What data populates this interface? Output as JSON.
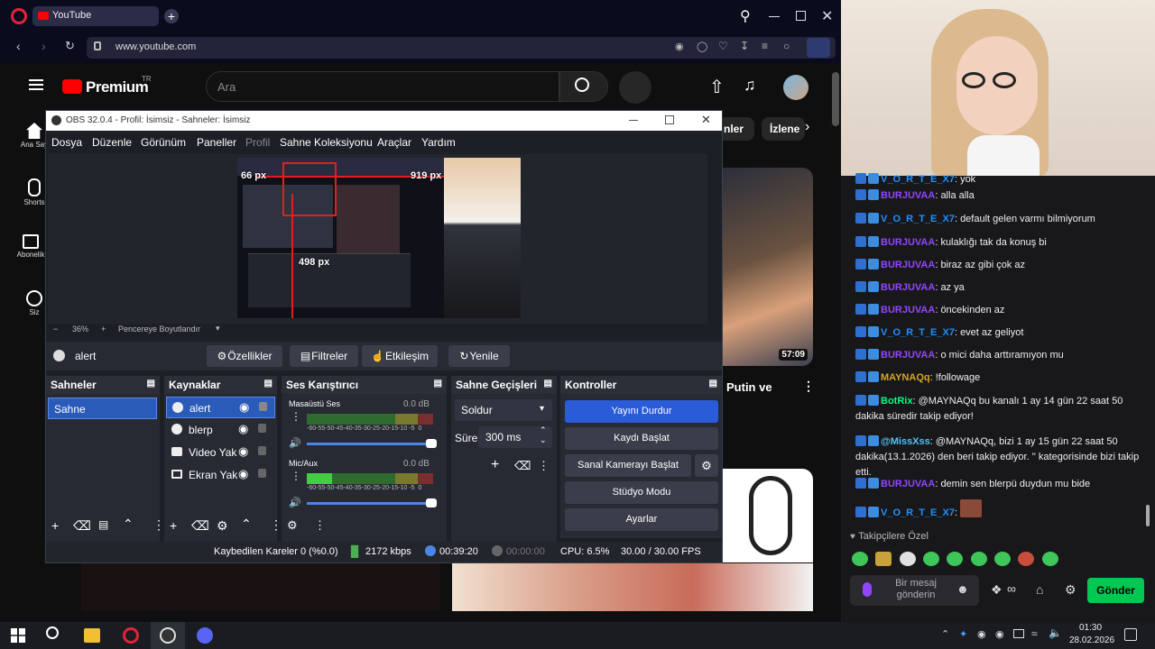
{
  "browser": {
    "tab_title": "YouTube",
    "url": "www.youtube.com"
  },
  "youtube": {
    "logo": "Premium",
    "region": "TR",
    "search_placeholder": "Ara",
    "sidebar": [
      {
        "label": "Ana Say",
        "icon": "home-icon"
      },
      {
        "label": "Shorts",
        "icon": "shorts-icon"
      },
      {
        "label": "Abonelik",
        "icon": "subscriptions-icon"
      },
      {
        "label": "Siz",
        "icon": "you-icon"
      }
    ],
    "chips": [
      "nler",
      "İzlene"
    ],
    "video_duration": "57:09",
    "video_title": "Putin ve"
  },
  "obs": {
    "title": "OBS 32.0.4 - Profil: İsimsiz - Sahneler: İsimsiz",
    "menu": [
      "Dosya",
      "Düzenle",
      "Görünüm",
      "Paneller",
      "Profil",
      "Sahne Koleksiyonu",
      "Araçlar",
      "Yardım"
    ],
    "preview_labels": {
      "px1": "66 px",
      "px2": "919 px",
      "px3": "498 px"
    },
    "zoom": "36%",
    "fit_label": "Pencereye Boyutlandır",
    "source_name": "alert",
    "source_buttons": [
      "Özellikler",
      "Filtreler",
      "Etkileşim",
      "Yenile"
    ],
    "scenes_header": "Sahneler",
    "scenes": [
      "Sahne"
    ],
    "sources_header": "Kaynaklar",
    "sources": [
      "alert",
      "blerp",
      "Video Yak",
      "Ekran Yak"
    ],
    "mixer_header": "Ses Karıştırıcı",
    "mixer": [
      {
        "name": "Masaüstü Ses",
        "db": "0.0 dB"
      },
      {
        "name": "Mic/Aux",
        "db": "0.0 dB"
      }
    ],
    "meter_scale": "-60-55-50-45-40-35-30-25-20-15-10 -5  0",
    "transitions_header": "Sahne Geçişleri",
    "transition_type": "Soldur",
    "duration_label": "Süre",
    "duration_value": "300 ms",
    "controls_header": "Kontroller",
    "controls": {
      "stop_stream": "Yayını Durdur",
      "start_record": "Kaydı Başlat",
      "virtual_cam": "Sanal Kamerayı Başlat",
      "studio_mode": "Stüdyo Modu",
      "settings": "Ayarlar"
    },
    "status": {
      "dropped": "Kaybedilen Kareler 0 (%0.0)",
      "bitrate": "2172 kbps",
      "stream_time": "00:39:20",
      "record_time": "00:00:00",
      "cpu": "CPU: 6.5%",
      "fps": "30.00 / 30.00 FPS"
    }
  },
  "chat": {
    "messages": [
      {
        "user": "V_O_R_T_E_X7",
        "text": "yok",
        "color": "#1e90ff"
      },
      {
        "user": "BURJUVAA",
        "text": "alla alla",
        "color": "#9146ff"
      },
      {
        "user": "V_O_R_T_E_X7",
        "text": "default gelen varmı bilmiyorum",
        "color": "#1e90ff"
      },
      {
        "user": "BURJUVAA",
        "text": "kulaklığı tak da konuş bi",
        "color": "#9146ff"
      },
      {
        "user": "BURJUVAA",
        "text": "biraz az gibi çok az",
        "color": "#9146ff"
      },
      {
        "user": "BURJUVAA",
        "text": "az ya",
        "color": "#9146ff"
      },
      {
        "user": "BURJUVAA",
        "text": "öncekinden az",
        "color": "#9146ff"
      },
      {
        "user": "V_O_R_T_E_X7",
        "text": "evet az geliyot",
        "color": "#1e90ff"
      },
      {
        "user": "BURJUVAA",
        "text": "o mici daha arttıramıyon mu",
        "color": "#9146ff"
      },
      {
        "user": "MAYNAQq",
        "text": "!followage",
        "color": "#daa520"
      },
      {
        "user": "BotRix",
        "text": "@MAYNAQq bu kanalı 1 ay 14 gün 22 saat 50 dakika süredir takip ediyor!",
        "color": "#00ff7f"
      },
      {
        "user": "@MissXss",
        "text": "@MAYNAQq, bizi 1 ay 15 gün 22 saat 50 dakika(13.1.2026) den beri takip ediyor. '' kategorisinde bizi takip etti.",
        "color": "#4fc3f7"
      },
      {
        "user": "BURJUVAA",
        "text": "demin sen blerpü duydun mu bide",
        "color": "#9146ff"
      },
      {
        "user": "V_O_R_T_E_X7",
        "text": "",
        "color": "#1e90ff"
      }
    ],
    "follower_label": "Takipçilere Özel",
    "input_placeholder": "Bir mesaj gönderin",
    "send_label": "Gönder"
  },
  "taskbar": {
    "time": "01:30",
    "date": "28.02.2026"
  }
}
